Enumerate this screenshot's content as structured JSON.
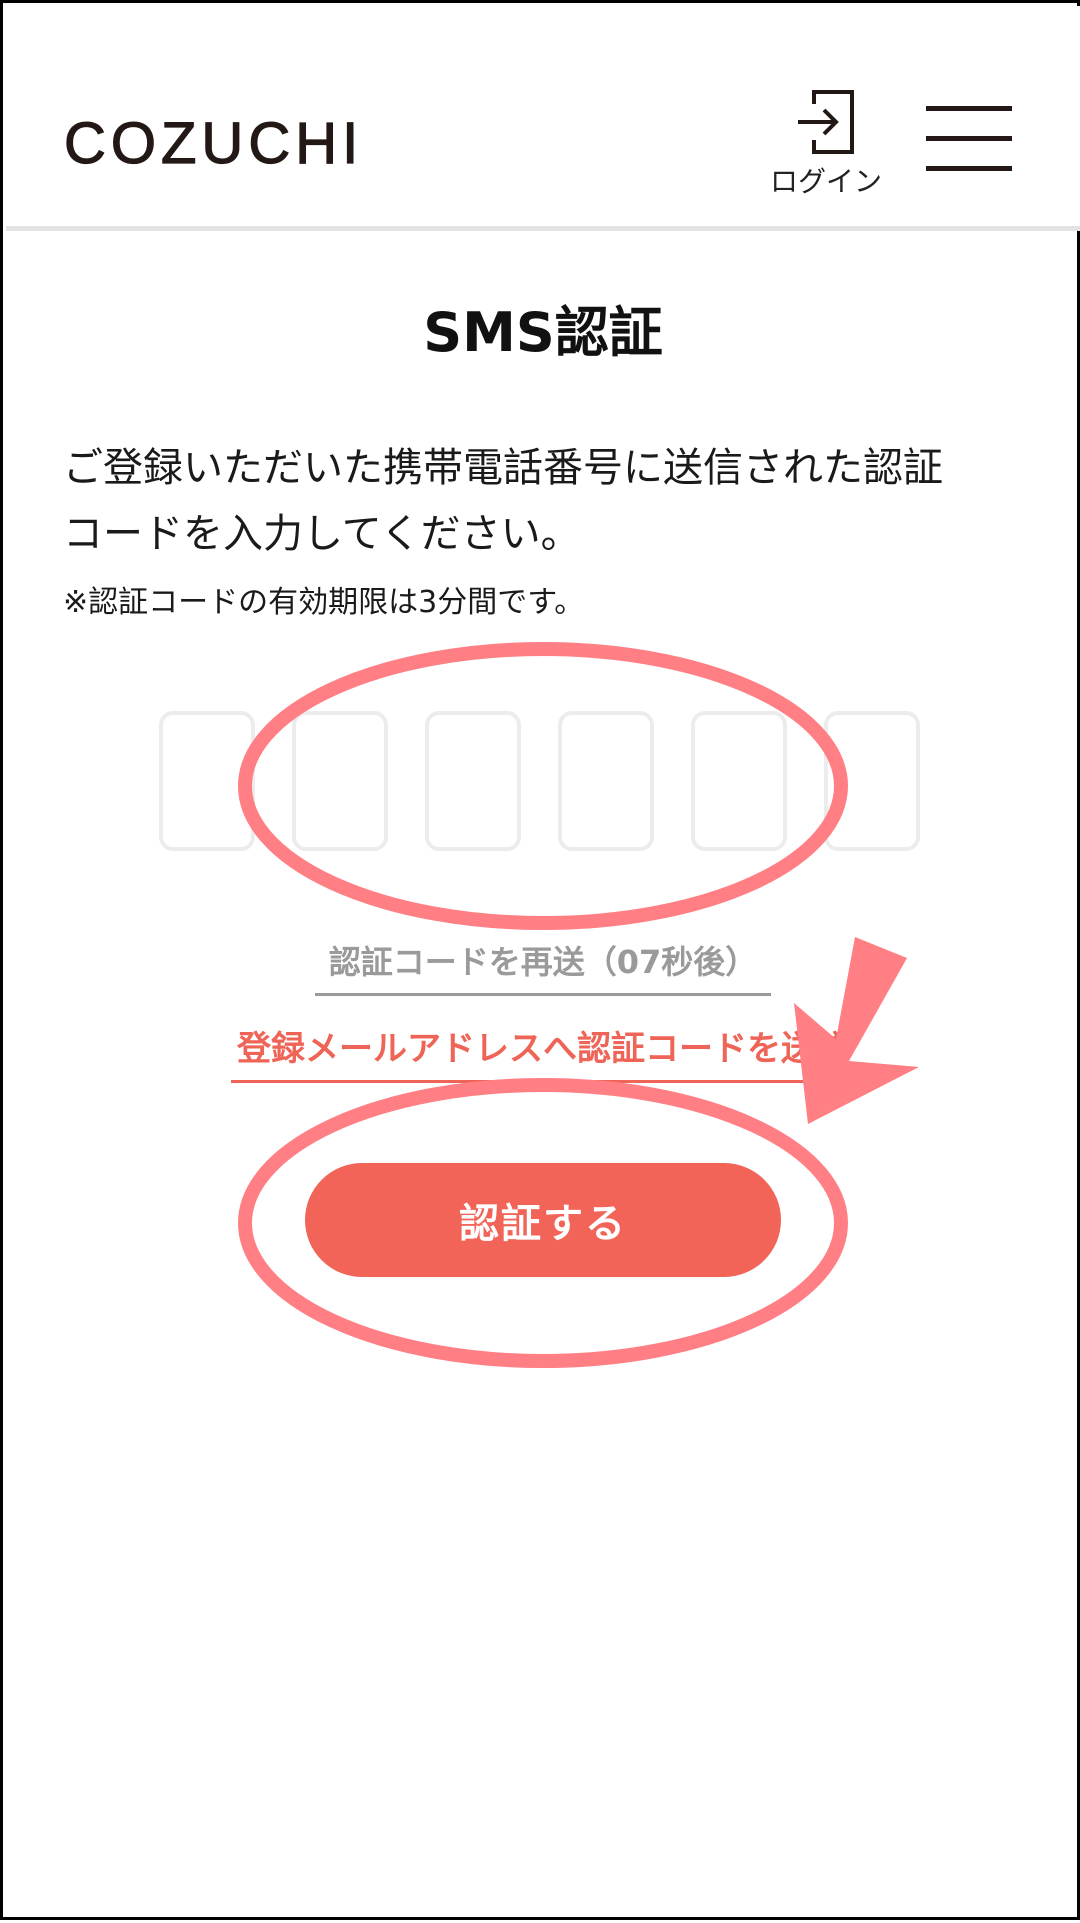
{
  "header": {
    "logo": "COZUCHI",
    "login_label": "ログイン",
    "login_icon": "login-icon",
    "menu_icon": "hamburger-menu-icon"
  },
  "main": {
    "title": "SMS認証",
    "description_line1": "ご登録いただいた携帯電話番号に送信された認証",
    "description_line2": "コードを入力してください。",
    "note": "※認証コードの有効期限は3分間です。",
    "code_digits": [
      "",
      "",
      "",
      "",
      "",
      ""
    ],
    "resend_label": "認証コードを再送（07秒後）",
    "email_link_label": "登録メールアドレスへ認証コードを送信",
    "submit_label": "認証する"
  },
  "colors": {
    "accent": "#f26457",
    "link": "#ee6457",
    "muted": "#9a9a9a",
    "annotation": "#ff7f84"
  }
}
